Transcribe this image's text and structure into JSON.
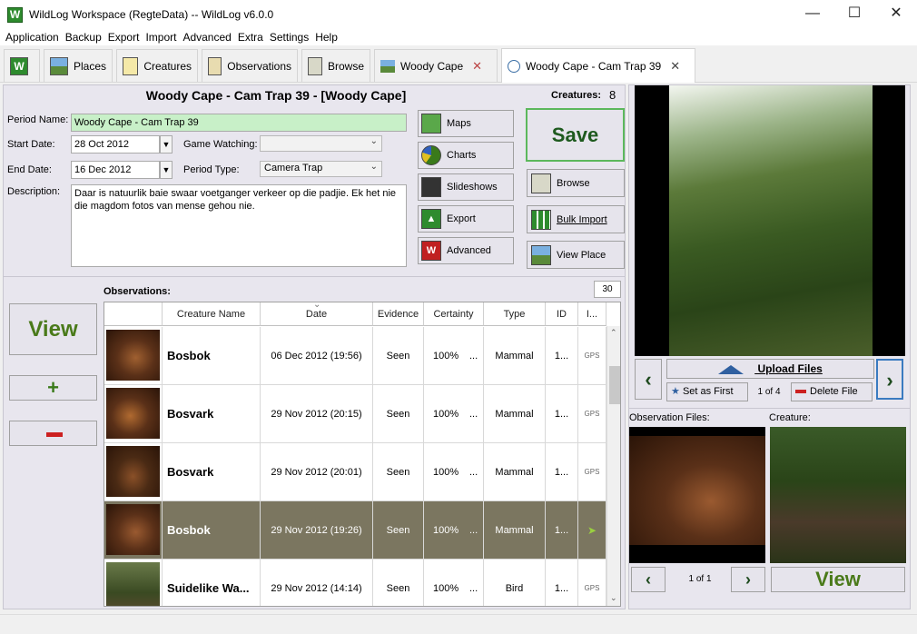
{
  "window": {
    "title": "WildLog Workspace (RegteData) -- WildLog v6.0.0",
    "app_icon_letter": "W",
    "controls": [
      "—",
      "☐",
      "✕"
    ]
  },
  "menu": [
    "Application",
    "Backup",
    "Export",
    "Import",
    "Advanced",
    "Extra",
    "Settings",
    "Help"
  ],
  "tabs": [
    {
      "label": "",
      "icon": "wildlog-home-icon"
    },
    {
      "label": "Places",
      "icon": "landscape-icon"
    },
    {
      "label": "Creatures",
      "icon": "paw-icon"
    },
    {
      "label": "Observations",
      "icon": "notebook-icon"
    },
    {
      "label": "Browse",
      "icon": "browse-icon"
    },
    {
      "label": "Woody Cape",
      "icon": "landscape-icon",
      "close": "✕"
    },
    {
      "label": "Woody Cape - Cam Trap 39",
      "icon": "clock-icon",
      "close": "✕"
    }
  ],
  "period": {
    "header_title": "Woody Cape - Cam Trap 39 - [Woody Cape]",
    "creatures_label": "Creatures:",
    "creatures_count": "8",
    "labels": {
      "name": "Period Name:",
      "start": "Start Date:",
      "end": "End Date:",
      "description": "Description:",
      "game_watching": "Game Watching:",
      "period_type": "Period Type:"
    },
    "name_value": "Woody Cape - Cam Trap 39",
    "start_date": "28 Oct 2012",
    "end_date": "16 Dec 2012",
    "game_watching_value": "",
    "period_type_value": "Camera Trap",
    "description_value": "Daar is natuurlik baie swaar voetganger verkeer op die padjie. Ek het nie die magdom fotos van mense gehou nie."
  },
  "action_buttons": {
    "maps": "Maps",
    "charts": "Charts",
    "slideshows": "Slideshows",
    "export": "Export",
    "advanced": "Advanced",
    "save": "Save",
    "browse": "Browse",
    "bulk_import": "Bulk Import",
    "view_place": "View Place"
  },
  "observations": {
    "label": "Observations:",
    "count": "30",
    "view_label": "View",
    "add_label": "+",
    "columns": [
      "",
      "Creature Name",
      "Date",
      "Evidence",
      "Certainty",
      "Type",
      "ID",
      "I..."
    ],
    "sort_indicator": "⌄",
    "rows": [
      {
        "name": "Bosbok",
        "date": "06 Dec 2012 (19:56)",
        "evidence": "Seen",
        "certainty": "100%",
        "dots": "...",
        "type": "Mammal",
        "id": "1...",
        "gps": "GPS",
        "selected": false
      },
      {
        "name": "Bosvark",
        "date": "29 Nov 2012 (20:15)",
        "evidence": "Seen",
        "certainty": "100%",
        "dots": "...",
        "type": "Mammal",
        "id": "1...",
        "gps": "GPS",
        "selected": false
      },
      {
        "name": "Bosvark",
        "date": "29 Nov 2012 (20:01)",
        "evidence": "Seen",
        "certainty": "100%",
        "dots": "...",
        "type": "Mammal",
        "id": "1...",
        "gps": "GPS",
        "selected": false
      },
      {
        "name": "Bosbok",
        "date": "29 Nov 2012 (19:26)",
        "evidence": "Seen",
        "certainty": "100%",
        "dots": "...",
        "type": "Mammal",
        "id": "1...",
        "gps": "",
        "selected": true
      },
      {
        "name": "Suidelike Wa...",
        "date": "29 Nov 2012 (14:14)",
        "evidence": "Seen",
        "certainty": "100%",
        "dots": "...",
        "type": "Bird",
        "id": "1...",
        "gps": "GPS",
        "selected": false
      }
    ]
  },
  "media": {
    "upload_label": "Upload Files",
    "set_first_label": "Set as First",
    "page_info": "1 of 4",
    "delete_file_label": "Delete File",
    "obs_files_label": "Observation Files:",
    "creature_label": "Creature:",
    "bottom_page_info": "1 of 1",
    "view_label": "View"
  },
  "colors": {
    "accent_green": "#5cb85c",
    "selected_row": "#7b7660",
    "panel_bg": "#e8e6ee",
    "name_field_bg": "#c8f0c8"
  }
}
